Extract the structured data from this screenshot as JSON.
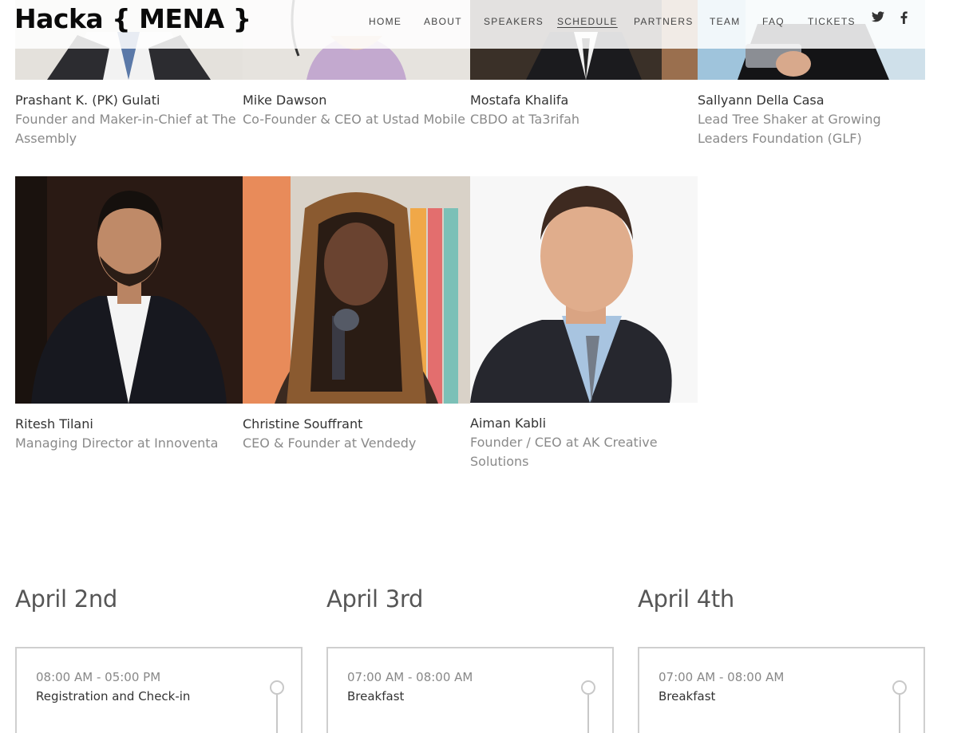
{
  "header": {
    "logo": "Hacka { MENA }",
    "nav": [
      "HOME",
      "ABOUT",
      "SPEAKERS",
      "SCHEDULE",
      "PARTNERS",
      "TEAM",
      "FAQ",
      "TICKETS"
    ],
    "active_nav": "SCHEDULE",
    "social": [
      "twitter-icon",
      "facebook-icon"
    ]
  },
  "speakers": [
    {
      "name": "Prashant K. (PK) Gulati",
      "role": "Founder and Maker-in-Chief at The Assembly"
    },
    {
      "name": "Mike Dawson",
      "role": "Co-Founder & CEO at Ustad Mobile"
    },
    {
      "name": "Mostafa Khalifa",
      "role": "CBDO at Ta3rifah"
    },
    {
      "name": "Sallyann Della Casa",
      "role": "Lead Tree Shaker at Growing Leaders Foundation (GLF)"
    },
    {
      "name": "Ritesh Tilani",
      "role": "Managing Director at Innoventa"
    },
    {
      "name": "Christine Souffrant",
      "role": "CEO & Founder at Vendedy"
    },
    {
      "name": "Aiman Kabli",
      "role": "Founder / CEO at AK Creative Solutions"
    }
  ],
  "schedule": [
    {
      "day": "April 2nd",
      "time": "08:00 AM - 05:00 PM",
      "title": "Registration and Check-in"
    },
    {
      "day": "April 3rd",
      "time": "07:00 AM - 08:00 AM",
      "title": "Breakfast"
    },
    {
      "day": "April 4th",
      "time": "07:00 AM - 08:00 AM",
      "title": "Breakfast"
    }
  ]
}
